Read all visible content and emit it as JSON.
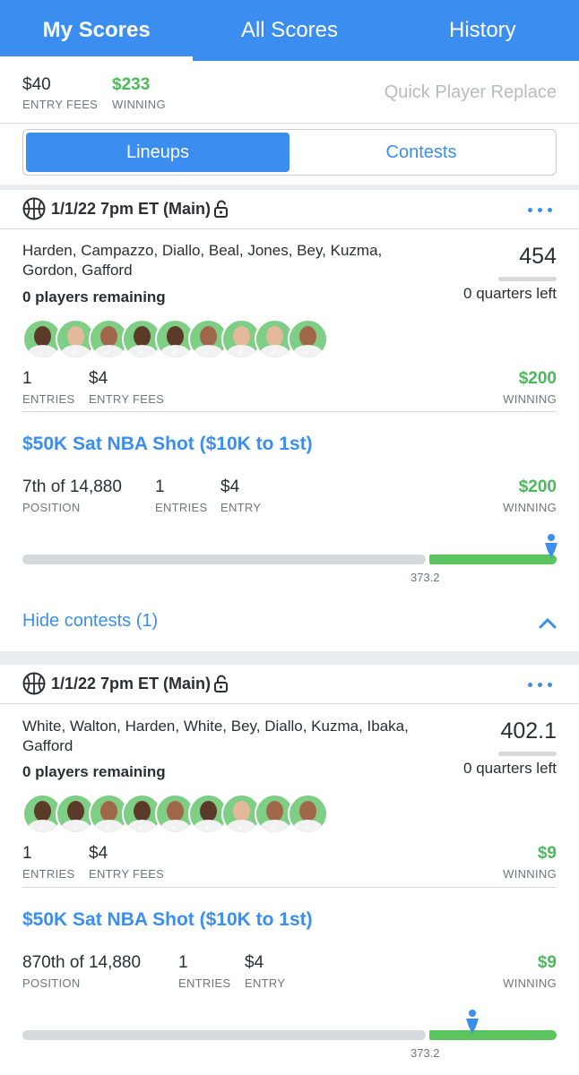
{
  "tabs": [
    {
      "label": "My Scores",
      "active": true
    },
    {
      "label": "All Scores",
      "active": false
    },
    {
      "label": "History",
      "active": false
    }
  ],
  "summary": {
    "entry_fees": "$40",
    "entry_fees_label": "ENTRY FEES",
    "winning": "$233",
    "winning_label": "WINNING",
    "quick_replace": "Quick Player Replace"
  },
  "segments": [
    {
      "label": "Lineups",
      "active": true
    },
    {
      "label": "Contests",
      "active": false
    }
  ],
  "colors": {
    "accent": "#3b8ef0",
    "green": "#4cb95a",
    "muted": "#6f767c"
  },
  "icons": [
    "basketball-icon",
    "unlock-icon",
    "more-icon",
    "checkmark-icon",
    "position-marker-icon",
    "chevron-up-icon"
  ],
  "lineups": [
    {
      "slate": "1/1/22 7pm ET (Main)",
      "players": "Harden, Campazzo, Diallo, Beal, Jones, Bey, Kuzma, Gordon, Gafford",
      "remaining": "0 players remaining",
      "score": "454",
      "quarters": "0 quarters left",
      "entries": "1",
      "entries_label": "ENTRIES",
      "fees": "$4",
      "fees_label": "ENTRY FEES",
      "winning": "$200",
      "winning_label": "WINNING",
      "contest": {
        "title": "$50K Sat NBA Shot ($10K to 1st)",
        "position": "7th of 14,880",
        "position_label": "POSITION",
        "entries": "1",
        "entries_label": "ENTRIES",
        "entry": "$4",
        "entry_label": "ENTRY",
        "winning": "$200",
        "winning_label": "WINNING",
        "cash_line": "373.2"
      },
      "hide_label": "Hide contests (1)"
    },
    {
      "slate": "1/1/22 7pm ET (Main)",
      "players": "White, Walton, Harden, White, Bey, Diallo, Kuzma, Ibaka, Gafford",
      "remaining": "0 players remaining",
      "score": "402.1",
      "quarters": "0 quarters left",
      "entries": "1",
      "entries_label": "ENTRIES",
      "fees": "$4",
      "fees_label": "ENTRY FEES",
      "winning": "$9",
      "winning_label": "WINNING",
      "contest": {
        "title": "$50K Sat NBA Shot ($10K to 1st)",
        "position": "870th of 14,880",
        "position_label": "POSITION",
        "entries": "1",
        "entries_label": "ENTRIES",
        "entry": "$4",
        "entry_label": "ENTRY",
        "winning": "$9",
        "winning_label": "WINNING",
        "cash_line": "373.2"
      }
    }
  ]
}
